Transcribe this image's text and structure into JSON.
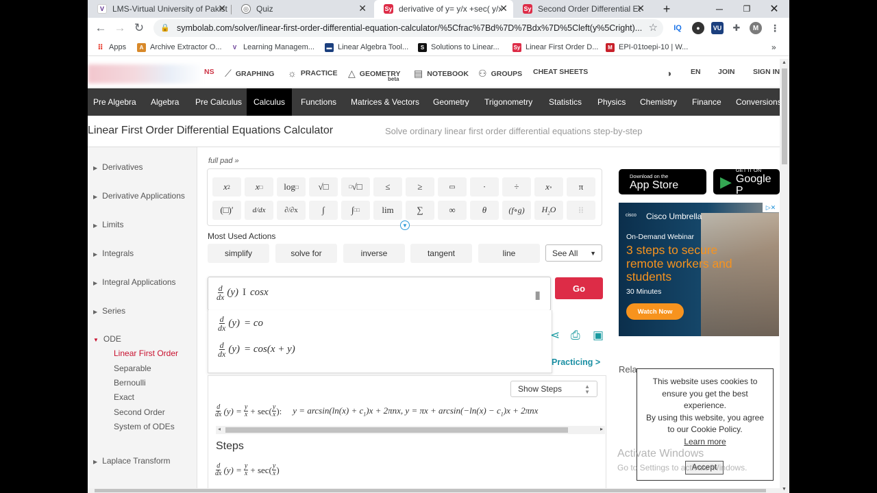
{
  "browser": {
    "tabs": [
      {
        "label": "LMS-Virtual University of Pakist",
        "icon": "vu-logo-icon"
      },
      {
        "label": "Quiz",
        "icon": "globe-icon"
      },
      {
        "label": "derivative of y= y/x +sec( y/x )",
        "icon": "symbolab-icon"
      },
      {
        "label": "Second Order Differential Equa",
        "icon": "symbolab-icon"
      }
    ],
    "url": "symbolab.com/solver/linear-first-order-differential-equation-calculator/%5Cfrac%7Bd%7D%7Bdx%7D%5Cleft(y%5Cright)...",
    "bookmarks": [
      {
        "label": "Apps"
      },
      {
        "label": "Archive Extractor O..."
      },
      {
        "label": "Learning Managem..."
      },
      {
        "label": "Linear Algebra Tool..."
      },
      {
        "label": "Solutions to Linear..."
      },
      {
        "label": "Linear First Order D..."
      },
      {
        "label": "EPI-01toepi-10 | W..."
      }
    ]
  },
  "site": {
    "nav": {
      "solutions": "NS",
      "graphing": "GRAPHING",
      "practice": "PRACTICE",
      "geometry": "GEOMETRY",
      "beta": "beta",
      "notebook": "NOTEBOOK",
      "groups": "GROUPS",
      "cheat_sheets": "CHEAT SHEETS",
      "lang": "EN",
      "join": "JOIN",
      "sign_in": "SIGN IN"
    },
    "categories": [
      "Pre Algebra",
      "Algebra",
      "Pre Calculus",
      "Calculus",
      "Functions",
      "Matrices & Vectors",
      "Geometry",
      "Trigonometry",
      "Statistics",
      "Physics",
      "Chemistry",
      "Finance",
      "Conversions"
    ],
    "page_title": "Linear First Order Differential Equations Calculator",
    "page_subtitle": "Solve ordinary linear first order differential equations step-by-step"
  },
  "sidebar": {
    "items": [
      "Derivatives",
      "Derivative Applications",
      "Limits",
      "Integrals",
      "Integral Applications",
      "Series",
      "ODE"
    ],
    "ode_sub": [
      "Linear First Order",
      "Separable",
      "Bernoulli",
      "Exact",
      "Second Order",
      "System of ODEs"
    ],
    "bottom": "Laplace Transform"
  },
  "main": {
    "full_pad": "full pad »",
    "most_used": "Most Used Actions",
    "actions": [
      "simplify",
      "solve for",
      "inverse",
      "tangent",
      "line"
    ],
    "see_all": "See All",
    "go": "Go",
    "input_rhs": "cosx",
    "suggestions": [
      "= co",
      "= cos(x + y)"
    ],
    "show_steps": "Show Steps",
    "steps_label": "Steps",
    "practicing": "Practicing >"
  },
  "right": {
    "app_store_small": "Download on the",
    "app_store_big": "App Store",
    "google_small": "GET IT ON",
    "google_big": "Google P",
    "ad": {
      "brand": "Cisco Umbrella",
      "cisco": "cisco",
      "webinar": "On-Demand Webinar",
      "headline": "3 steps to secure remote workers and students",
      "minutes": "30 Minutes",
      "cta": "Watch Now"
    },
    "related": "Rela",
    "cookie": {
      "text1": "This website uses cookies to ensure you get the best experience.",
      "text2": "By using this website, you agree to our Cookie Policy.",
      "learn": "Learn more",
      "accept": "Accept"
    },
    "activate1": "Activate Windows",
    "activate2": "Go to Settings to activate Windows."
  }
}
